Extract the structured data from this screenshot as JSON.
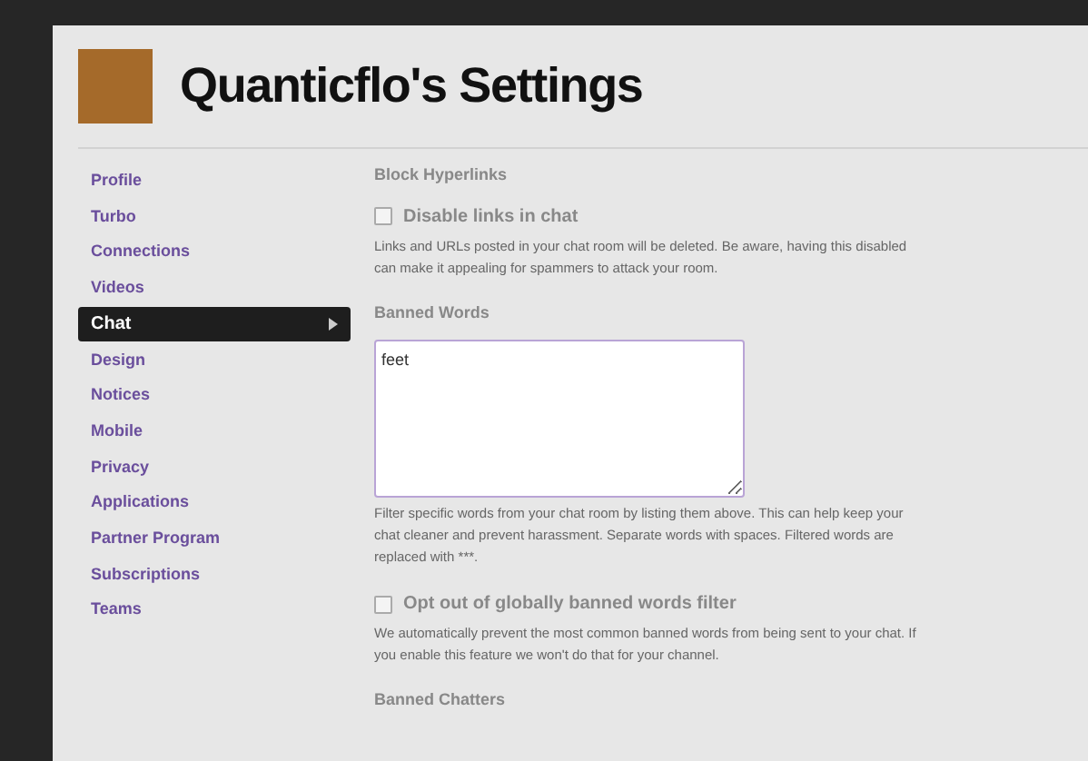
{
  "header": {
    "title": "Quanticflo's Settings"
  },
  "sidebar": {
    "items": [
      {
        "label": "Profile",
        "selected": false
      },
      {
        "label": "Turbo",
        "selected": false
      },
      {
        "label": "Connections",
        "selected": false
      },
      {
        "label": "Videos",
        "selected": false
      },
      {
        "label": "Chat",
        "selected": true
      },
      {
        "label": "Design",
        "selected": false
      },
      {
        "label": "Notices",
        "selected": false
      },
      {
        "label": "Mobile",
        "selected": false
      },
      {
        "label": "Privacy",
        "selected": false
      },
      {
        "label": "Applications",
        "selected": false
      },
      {
        "label": "Partner Program",
        "selected": false
      },
      {
        "label": "Subscriptions",
        "selected": false
      },
      {
        "label": "Teams",
        "selected": false
      }
    ]
  },
  "sections": [
    {
      "kind": "checkbox",
      "heading": "Block Hyperlinks",
      "label": "Disable links in chat",
      "checked": false,
      "description": "Links and URLs posted in your chat room will be deleted. Be aware, having this disabled can make it appealing for spammers to attack your room."
    },
    {
      "kind": "textarea",
      "heading": "Banned Words",
      "value": "feet",
      "description": "Filter specific words from your chat room by listing them above. This can help keep your chat cleaner and prevent harassment. Separate words with spaces. Filtered words are replaced with ***."
    },
    {
      "kind": "checkbox",
      "label": "Opt out of globally banned words filter",
      "checked": false,
      "description": "We automatically prevent the most common banned words from being sent to your chat. If you enable this feature we won't do that for your channel."
    },
    {
      "kind": "heading",
      "heading": "Banned Chatters"
    }
  ]
}
